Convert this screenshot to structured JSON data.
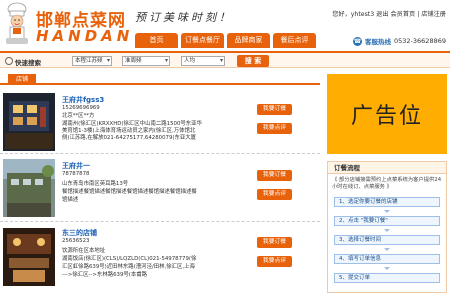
{
  "brand": {
    "logo_cn": "邯郸点菜网",
    "logo_en": "HANDAN",
    "slogan": "预订美味时刻！"
  },
  "userbar": {
    "text": "您好，yhtest3 退出 会员首页 | 店铺注册"
  },
  "nav": {
    "items": [
      "首页",
      "订餐点餐厅",
      "品牌商家",
      "餐后点评"
    ]
  },
  "hotline": {
    "label": "客服热线",
    "number": "0532-36628869"
  },
  "search": {
    "label": "快速搜索",
    "area": "本程江苏频",
    "category": "准周频",
    "people": "人均",
    "button": "搜 索"
  },
  "section": {
    "tab": "店铺"
  },
  "shops": [
    {
      "name": "王府井fgss3",
      "phone": "15269696969",
      "city": "北京**区**方",
      "desc1": "湖南州(徐汇区)KRXXHD(徐汇区中山南二路1500号东亚华",
      "desc2": "美育馆1-3楼)上海体育场运动员之家内(徐汇区,万体馆北",
      "desc3": "侧)江苏路,在解放021-64275177,64280079(东亚大厦",
      "btn1": "我要订餐",
      "btn2": "我要点评"
    },
    {
      "name": "王府井一",
      "phone": "78787878",
      "city": "山东青岛市南区英耳路13号",
      "desc1": "餐馆描述餐馆描述餐馆描述餐馆描述餐馆描述餐馆描述餐",
      "desc2": "馆描述",
      "desc3": "",
      "btn1": "我要订餐",
      "btn2": "我要点评"
    },
    {
      "name": "东三的店铺",
      "phone": "25636523",
      "city": "饮源所在区本地址",
      "desc1": "湖南饭店(徐汇区)(CLS)/LQZLD(CL)021-54978779(徐",
      "desc2": "汇区虹徐路639号)近田林东路(漕河泾/田林,徐汇区,上海",
      "desc3": "--->徐汇区-->东林路639号(本甫路",
      "btn1": "我要订餐",
      "btn2": "我要点评"
    }
  ],
  "ad": {
    "text": "广告位"
  },
  "flow": {
    "title": "订餐流程",
    "desc": "《 部分店铺接需预约上点菜系统为客户提供24小时在线订、点菜服务 》",
    "steps": [
      "1、选定你要订餐的店铺",
      "2、点击 \"我要订餐\"",
      "3、选择订餐时间",
      "4、填写订单信息",
      "5、提交订单"
    ]
  },
  "colors": {
    "accent": "#e8620c",
    "link": "#1a5fb4",
    "ad": "#ffad00"
  }
}
